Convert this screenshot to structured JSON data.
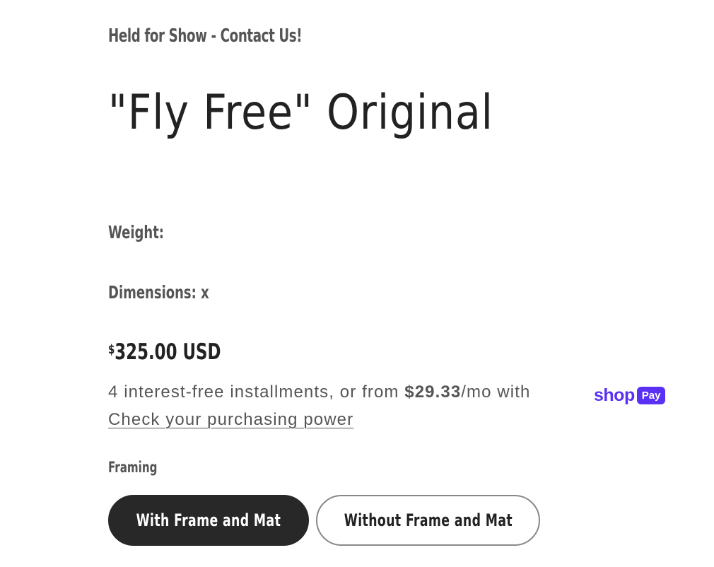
{
  "product": {
    "availability_note": "Held for Show - Contact Us!",
    "title": "\"Fly Free\" Original",
    "weight_label": "Weight:",
    "dimensions_label": "Dimensions: x",
    "price": {
      "currency_symbol": "$",
      "amount_text": "325.00 USD"
    }
  },
  "installments": {
    "prefix": "4 interest-free installments, or from ",
    "monthly_amount": "$29.33",
    "suffix": "/mo with",
    "shop_word": "shop",
    "pay_badge": "Pay",
    "link_text": "Check your purchasing power",
    "brand_color": "#5a31f4"
  },
  "options": {
    "framing_label": "Framing",
    "choices": [
      {
        "label": "With Frame and Mat",
        "selected": true
      },
      {
        "label": "Without Frame and Mat",
        "selected": false
      }
    ]
  }
}
